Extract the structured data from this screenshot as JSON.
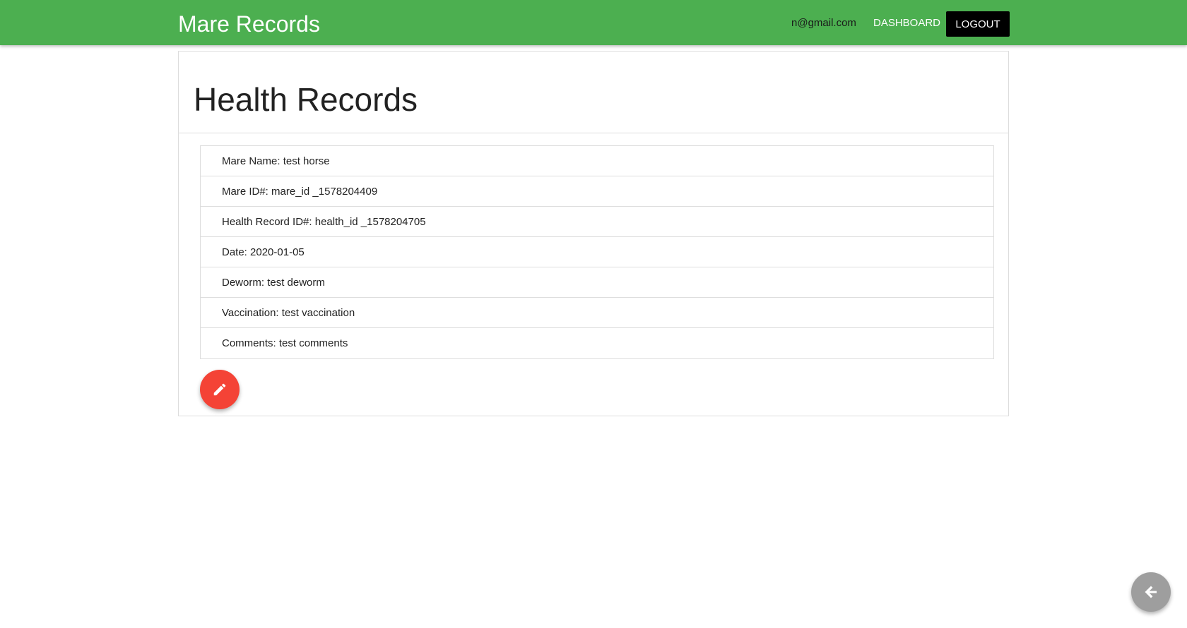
{
  "navbar": {
    "brand": "Mare Records",
    "email": "n@gmail.com",
    "dashboard_label": "DASHBOARD",
    "logout_label": "LOGOUT",
    "bg_color": "#4caf50"
  },
  "page": {
    "title": "Health Records"
  },
  "record": [
    {
      "label": "Mare Name:",
      "value": "test horse"
    },
    {
      "label": "Mare ID#:",
      "value": "mare_id _1578204409"
    },
    {
      "label": "Health Record ID#:",
      "value": "health_id _1578204705"
    },
    {
      "label": "Date:",
      "value": "2020-01-05"
    },
    {
      "label": "Deworm:",
      "value": "test deworm"
    },
    {
      "label": "Vaccination:",
      "value": "test vaccination"
    },
    {
      "label": "Comments:",
      "value": "test comments"
    }
  ],
  "buttons": {
    "edit_icon": "pencil-icon",
    "edit_color": "#f44336",
    "back_icon": "arrow-left-icon",
    "back_color": "#9e9e9e"
  }
}
